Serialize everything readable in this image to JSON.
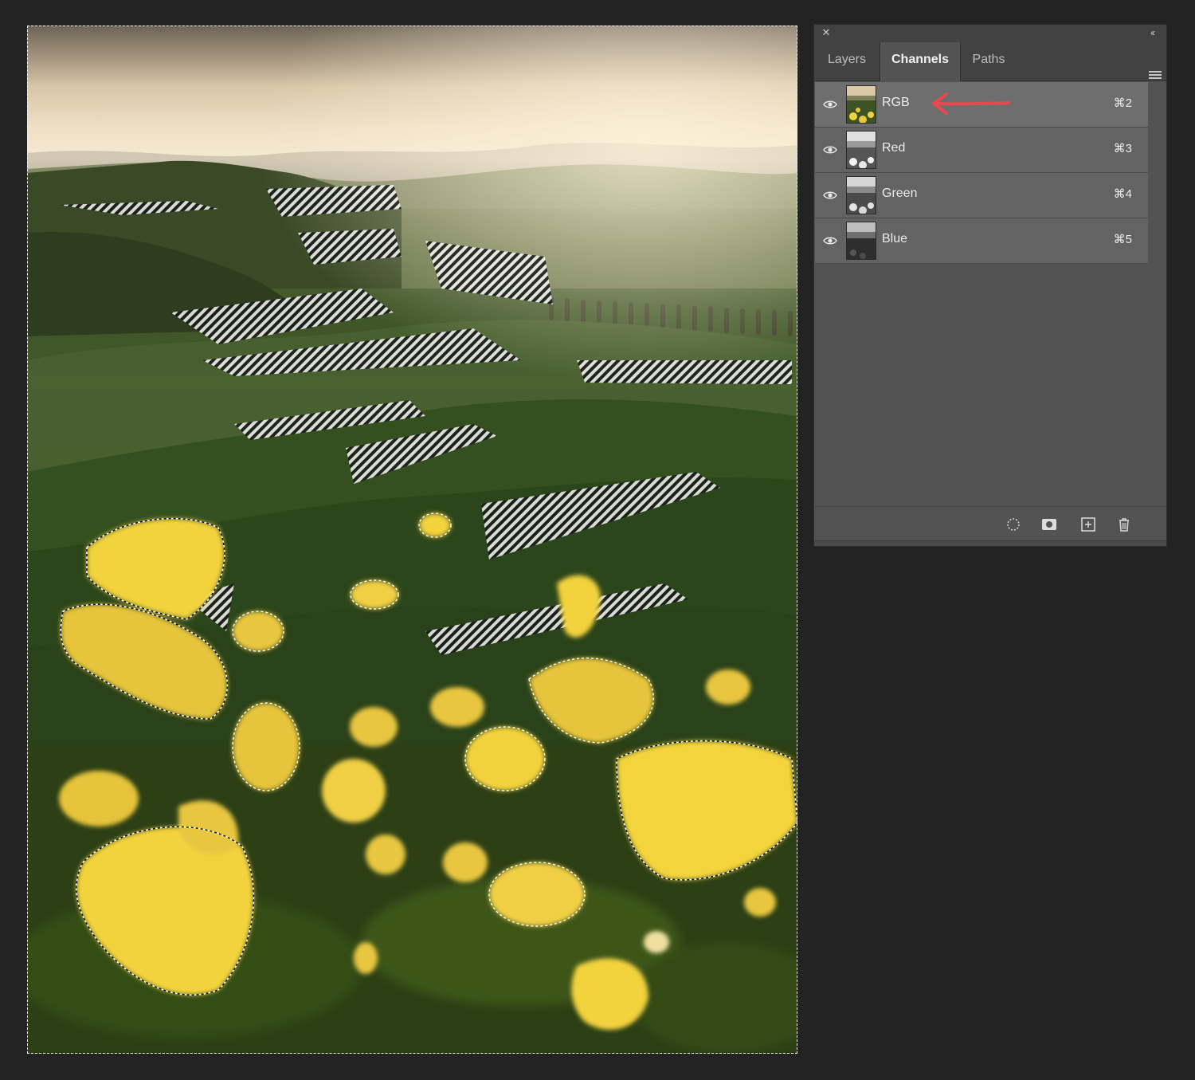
{
  "panel": {
    "tabs": [
      {
        "label": "Layers",
        "active": false
      },
      {
        "label": "Channels",
        "active": true
      },
      {
        "label": "Paths",
        "active": false
      }
    ],
    "close_icon": "close-icon",
    "collapse_glyph": "‹‹",
    "channels": [
      {
        "name": "RGB",
        "shortcut": "⌘2",
        "visible": true,
        "selected": true
      },
      {
        "name": "Red",
        "shortcut": "⌘3",
        "visible": true,
        "selected": false
      },
      {
        "name": "Green",
        "shortcut": "⌘4",
        "visible": true,
        "selected": false
      },
      {
        "name": "Blue",
        "shortcut": "⌘5",
        "visible": true,
        "selected": false
      }
    ],
    "footer_icons": [
      "load-selection-icon",
      "save-selection-icon",
      "new-channel-icon",
      "delete-channel-icon"
    ]
  },
  "colors": {
    "panel_bg": "#535353",
    "app_bg": "#232323",
    "annotation_arrow": "#e8494f",
    "flower_yellow": "#f2cf3a"
  }
}
